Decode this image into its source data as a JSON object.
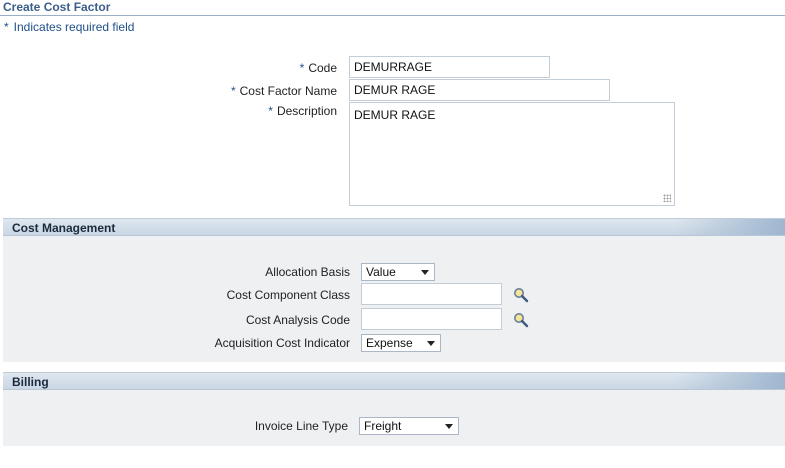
{
  "page": {
    "title": "Create Cost Factor",
    "required_note": "Indicates required field",
    "required_star": "*"
  },
  "header_fields": {
    "code": {
      "label": "Code",
      "value": "DEMURRAGE"
    },
    "cost_factor_name": {
      "label": "Cost Factor Name",
      "value": "DEMUR RAGE"
    },
    "description": {
      "label": "Description",
      "value": "DEMUR RAGE"
    }
  },
  "cost_management": {
    "title": "Cost Management",
    "allocation_basis": {
      "label": "Allocation Basis",
      "value": "Value"
    },
    "cost_component_class": {
      "label": "Cost Component Class",
      "value": ""
    },
    "cost_analysis_code": {
      "label": "Cost Analysis Code",
      "value": ""
    },
    "acquisition_cost_indicator": {
      "label": "Acquisition Cost Indicator",
      "value": "Expense"
    }
  },
  "billing": {
    "title": "Billing",
    "invoice_line_type": {
      "label": "Invoice Line Type",
      "value": "Freight"
    }
  },
  "icons": {
    "search": "search-icon",
    "dropdown": "chevron-down-icon",
    "resize": "resize-grip-icon"
  },
  "colors": {
    "title_blue": "#3c5d8a",
    "required_blue": "#1f4f8a",
    "section_bg": "#eef0f2"
  }
}
